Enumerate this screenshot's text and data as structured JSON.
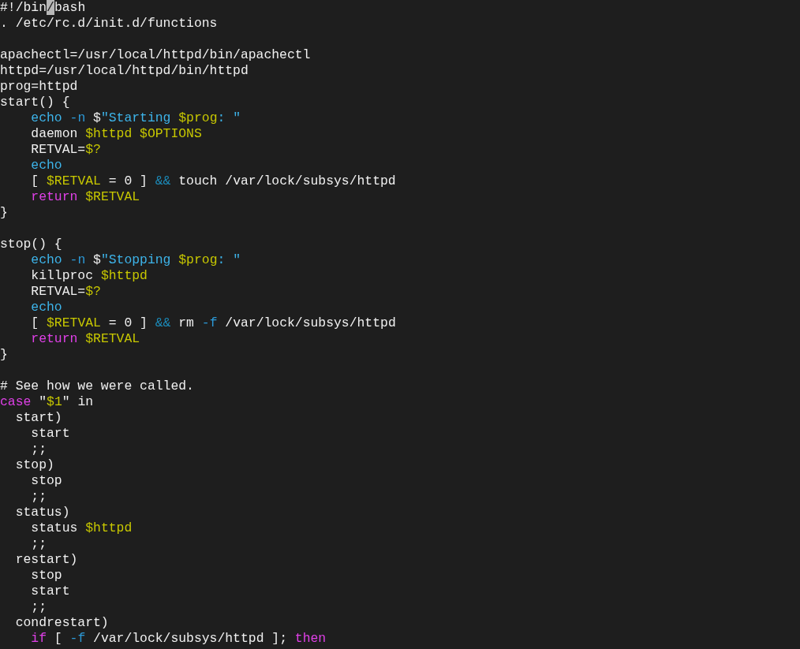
{
  "editor": {
    "lines": [
      {
        "segments": [
          {
            "text": "#!/bin",
            "kind": "plain"
          },
          {
            "text": "/",
            "kind": "cursor"
          },
          {
            "text": "bash",
            "kind": "plain"
          }
        ]
      },
      {
        "segments": [
          {
            "text": ". /etc/rc.d/init.d/functions",
            "kind": "plain"
          }
        ]
      },
      {
        "blank_line_before": true,
        "segments": [
          {
            "text": "apachectl=/usr/local/httpd/bin/apachectl",
            "kind": "plain"
          }
        ]
      },
      {
        "segments": [
          {
            "text": "httpd=/usr/local/httpd/bin/httpd",
            "kind": "plain"
          }
        ]
      },
      {
        "segments": [
          {
            "text": "prog=httpd",
            "kind": "plain"
          }
        ]
      },
      {
        "segments": [
          {
            "text": "start() {",
            "kind": "plain"
          }
        ]
      },
      {
        "segments": [
          {
            "text": "    echo",
            "kind": "builtin"
          },
          {
            "text": " -n",
            "kind": "option"
          },
          {
            "text": " $",
            "kind": "plain"
          },
          {
            "text": "\"Starting ",
            "kind": "string"
          },
          {
            "text": "$prog",
            "kind": "variable"
          },
          {
            "text": ": \"",
            "kind": "string"
          }
        ]
      },
      {
        "segments": [
          {
            "text": "    daemon ",
            "kind": "plain"
          },
          {
            "text": "$httpd $OPTIONS",
            "kind": "variable"
          }
        ]
      },
      {
        "segments": [
          {
            "text": "    RETVAL=",
            "kind": "plain"
          },
          {
            "text": "$?",
            "kind": "variable"
          }
        ]
      },
      {
        "segments": [
          {
            "text": "    echo",
            "kind": "builtin"
          }
        ]
      },
      {
        "segments": [
          {
            "text": "    [ ",
            "kind": "plain"
          },
          {
            "text": "$RETVAL",
            "kind": "variable"
          },
          {
            "text": " = 0 ] ",
            "kind": "plain"
          },
          {
            "text": "&&",
            "kind": "operator"
          },
          {
            "text": " touch /var/lock/subsys/httpd",
            "kind": "plain"
          }
        ]
      },
      {
        "segments": [
          {
            "text": "    return",
            "kind": "keyword"
          },
          {
            "text": " $RETVAL",
            "kind": "variable"
          }
        ]
      },
      {
        "segments": [
          {
            "text": "}",
            "kind": "plain"
          }
        ]
      },
      {
        "blank_line_before": true,
        "segments": [
          {
            "text": "stop() {",
            "kind": "plain"
          }
        ]
      },
      {
        "segments": [
          {
            "text": "    echo",
            "kind": "builtin"
          },
          {
            "text": " -n",
            "kind": "option"
          },
          {
            "text": " $",
            "kind": "plain"
          },
          {
            "text": "\"Stopping ",
            "kind": "string"
          },
          {
            "text": "$prog",
            "kind": "variable"
          },
          {
            "text": ": \"",
            "kind": "string"
          }
        ]
      },
      {
        "segments": [
          {
            "text": "    killproc ",
            "kind": "plain"
          },
          {
            "text": "$httpd",
            "kind": "variable"
          }
        ]
      },
      {
        "segments": [
          {
            "text": "    RETVAL=",
            "kind": "plain"
          },
          {
            "text": "$?",
            "kind": "variable"
          }
        ]
      },
      {
        "segments": [
          {
            "text": "    echo",
            "kind": "builtin"
          }
        ]
      },
      {
        "segments": [
          {
            "text": "    [ ",
            "kind": "plain"
          },
          {
            "text": "$RETVAL",
            "kind": "variable"
          },
          {
            "text": " = 0 ] ",
            "kind": "plain"
          },
          {
            "text": "&&",
            "kind": "operator"
          },
          {
            "text": " rm ",
            "kind": "plain"
          },
          {
            "text": "-f",
            "kind": "option"
          },
          {
            "text": " /var/lock/subsys/httpd",
            "kind": "plain"
          }
        ]
      },
      {
        "segments": [
          {
            "text": "    return",
            "kind": "keyword"
          },
          {
            "text": " $RETVAL",
            "kind": "variable"
          }
        ]
      },
      {
        "segments": [
          {
            "text": "}",
            "kind": "plain"
          }
        ]
      },
      {
        "blank_line_before": true,
        "segments": [
          {
            "text": "# See how we were called.",
            "kind": "plain"
          }
        ]
      },
      {
        "segments": [
          {
            "text": "case",
            "kind": "keyword"
          },
          {
            "text": " \"",
            "kind": "plain"
          },
          {
            "text": "$1",
            "kind": "variable"
          },
          {
            "text": "\" in",
            "kind": "plain"
          }
        ]
      },
      {
        "segments": [
          {
            "text": "  start)",
            "kind": "plain"
          }
        ]
      },
      {
        "segments": [
          {
            "text": "    start",
            "kind": "plain"
          }
        ]
      },
      {
        "segments": [
          {
            "text": "    ;;",
            "kind": "plain"
          }
        ]
      },
      {
        "segments": [
          {
            "text": "  stop)",
            "kind": "plain"
          }
        ]
      },
      {
        "segments": [
          {
            "text": "    stop",
            "kind": "plain"
          }
        ]
      },
      {
        "segments": [
          {
            "text": "    ;;",
            "kind": "plain"
          }
        ]
      },
      {
        "segments": [
          {
            "text": "  status)",
            "kind": "plain"
          }
        ]
      },
      {
        "segments": [
          {
            "text": "    status ",
            "kind": "plain"
          },
          {
            "text": "$httpd",
            "kind": "variable"
          }
        ]
      },
      {
        "segments": [
          {
            "text": "    ;;",
            "kind": "plain"
          }
        ]
      },
      {
        "segments": [
          {
            "text": "  restart)",
            "kind": "plain"
          }
        ]
      },
      {
        "segments": [
          {
            "text": "    stop",
            "kind": "plain"
          }
        ]
      },
      {
        "segments": [
          {
            "text": "    start",
            "kind": "plain"
          }
        ]
      },
      {
        "segments": [
          {
            "text": "    ;;",
            "kind": "plain"
          }
        ]
      },
      {
        "segments": [
          {
            "text": "  condrestart)",
            "kind": "plain"
          }
        ]
      },
      {
        "segments": [
          {
            "text": "    if",
            "kind": "keyword"
          },
          {
            "text": " [ ",
            "kind": "plain"
          },
          {
            "text": "-f",
            "kind": "option"
          },
          {
            "text": " /var/lock/subsys/httpd ]; ",
            "kind": "plain"
          },
          {
            "text": "then",
            "kind": "keyword"
          }
        ]
      }
    ]
  }
}
